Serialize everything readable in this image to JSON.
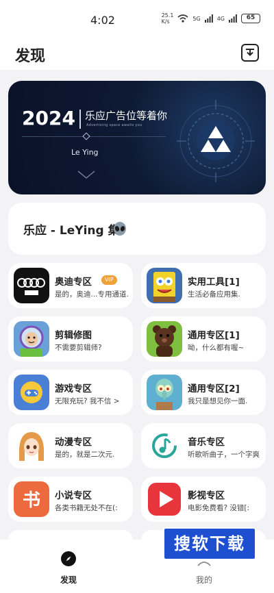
{
  "status_bar": {
    "time": "4:02",
    "net_speed_value": "25.1",
    "net_speed_unit": "K/s",
    "signal1": "5G",
    "signal2": "4G",
    "battery": "65"
  },
  "header": {
    "title": "发现"
  },
  "banner": {
    "year": "2024",
    "slogan": "乐应广告位等着你",
    "subtitle": "Advertising space awaits you",
    "brand": "Le Ying"
  },
  "collection": {
    "title": "乐应 - LeYing 集"
  },
  "cards": [
    {
      "title": "奥迪专区",
      "desc": "是的，奥迪...专用通道.",
      "badge": "VIP",
      "icon": "audi-logo-icon"
    },
    {
      "title": "实用工具[1]",
      "desc": "生活必备应用集.",
      "icon": "spongebob-icon"
    },
    {
      "title": "剪辑修图",
      "desc": "不需要剪辑师?",
      "icon": "astronaut-toy-icon"
    },
    {
      "title": "通用专区[1]",
      "desc": "呦，什么都有喔~",
      "icon": "teddy-bear-icon"
    },
    {
      "title": "游戏专区",
      "desc": "无限充玩? 我不信 >",
      "icon": "gamepad-icon"
    },
    {
      "title": "通用专区[2]",
      "desc": "我只是想见你一面.",
      "icon": "squidward-icon"
    },
    {
      "title": "动漫专区",
      "desc": "是的，就是二次元.",
      "icon": "anime-girl-icon"
    },
    {
      "title": "音乐专区",
      "desc": "听歌听曲子，一个字爽",
      "icon": "music-note-icon"
    },
    {
      "title": "小说专区",
      "desc": "各类书籍无处不在(:",
      "icon": "book-icon"
    },
    {
      "title": "影视专区",
      "desc": "电影免费看? 没错[:",
      "icon": "play-icon"
    }
  ],
  "nav": {
    "discover": "发现",
    "mine": "我的"
  },
  "watermark": {
    "text": "搜软下载"
  },
  "colors": {
    "accent": "#f0a23a",
    "banner_bg": "#0e1a33",
    "watermark_bg": "#1f4fd1"
  }
}
